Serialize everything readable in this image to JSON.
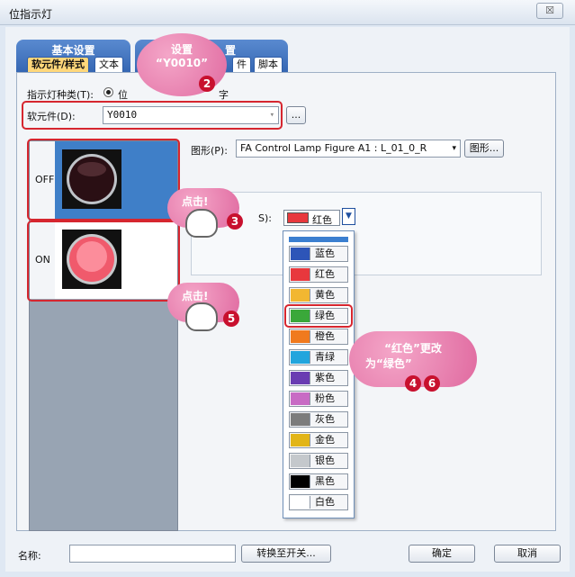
{
  "window": {
    "title": "位指示灯",
    "close_glyph": "☒"
  },
  "tabs": {
    "group1_title": "基本设置",
    "group2_title_partial": "置",
    "sub": [
      "软元件/样式",
      "文本",
      "件",
      "脚本"
    ]
  },
  "form": {
    "lamp_type_label": "指示灯种类(T):",
    "lamp_type_option": "位",
    "lamp_type_option2_partial": "字",
    "device_label": "软元件(D):",
    "device_value": "Y0010",
    "device_browse": "...",
    "figure_label": "图形(P):",
    "figure_value": "FA Control Lamp Figure A1 : L_01_0_R",
    "figure_button": "图形...",
    "color_label_partial": "S):",
    "color_value": "红色",
    "color_accent": "#e8383d"
  },
  "states": [
    {
      "label": "OFF",
      "lamp_color": "#3a1418"
    },
    {
      "label": "ON",
      "lamp_color": "#f26b7a"
    }
  ],
  "color_options": [
    {
      "name": "蓝色",
      "color": "#2d55b8"
    },
    {
      "name": "红色",
      "color": "#e8383d"
    },
    {
      "name": "黄色",
      "color": "#f2b731"
    },
    {
      "name": "绿色",
      "color": "#3aa83a"
    },
    {
      "name": "橙色",
      "color": "#f07a1e"
    },
    {
      "name": "青绿",
      "color": "#22a5dd"
    },
    {
      "name": "紫色",
      "color": "#6a3cb2"
    },
    {
      "name": "粉色",
      "color": "#c86bc4"
    },
    {
      "name": "灰色",
      "color": "#7c7c7c"
    },
    {
      "name": "金色",
      "color": "#e2b518"
    },
    {
      "name": "银色",
      "color": "#c4c8cc"
    },
    {
      "name": "黑色",
      "color": "#000000"
    },
    {
      "name": "白色",
      "color": "#ffffff"
    }
  ],
  "footer": {
    "name_label": "名称:",
    "name_value": "",
    "convert_button": "转换至开关...",
    "ok_button": "确定",
    "cancel_button": "取消"
  },
  "annotations": {
    "callout_set_line1": "设置",
    "callout_set_line2": "“Y0010”",
    "callout_click1": "点击!",
    "callout_click2": "点击!",
    "callout_color_line1": "“红色”更改",
    "callout_color_line2": "为“绿色”",
    "step2": "2",
    "step3": "3",
    "step5": "5",
    "step4": "4",
    "step6": "6"
  }
}
